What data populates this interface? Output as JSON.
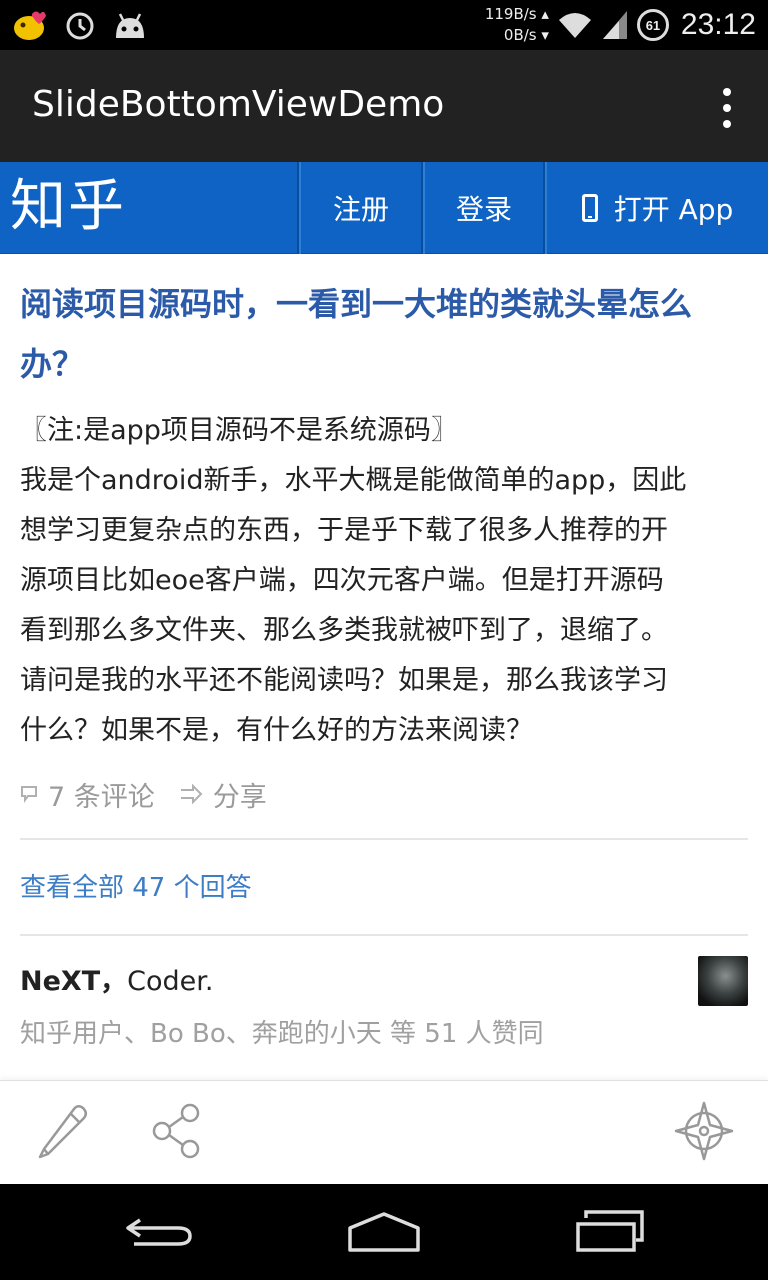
{
  "status_bar": {
    "net_up": "119B/s ▴",
    "net_down": "0B/s ▾",
    "battery": "61",
    "time": "23:12"
  },
  "action_bar": {
    "title": "SlideBottomViewDemo"
  },
  "zhihu_nav": {
    "logo": "知乎",
    "register": "注册",
    "login": "登录",
    "open_app": "打开 App"
  },
  "question": {
    "title": "阅读项目源码时，一看到一大堆的类就头晕怎么办？",
    "body_lines": [
      "〖注:是app项目源码不是系统源码〗",
      "我是个android新手，水平大概是能做简单的app，因此",
      "想学习更复杂点的东西，于是乎下载了很多人推荐的开",
      "源项目比如eoe客户端，四次元客户端。但是打开源码",
      "看到那么多文件夹、那么多类我就被吓到了，退缩了。",
      "请问是我的水平还不能阅读吗？如果是，那么我该学习",
      "什么？如果不是，有什么好的方法来阅读？"
    ],
    "comments": "7 条评论",
    "share": "分享"
  },
  "view_all": "查看全部 47 个回答",
  "answer": {
    "author": "NeXT",
    "separator": "，",
    "bio": "Coder.",
    "voters": "知乎用户、Bo Bo、奔跑的小天 等 51 人赞同"
  },
  "bottom_bar": {
    "icons": [
      "pencil-icon",
      "share-icon",
      "compass-icon"
    ]
  },
  "nav_bar": {
    "icons": [
      "back-icon",
      "home-icon",
      "recents-icon"
    ]
  }
}
